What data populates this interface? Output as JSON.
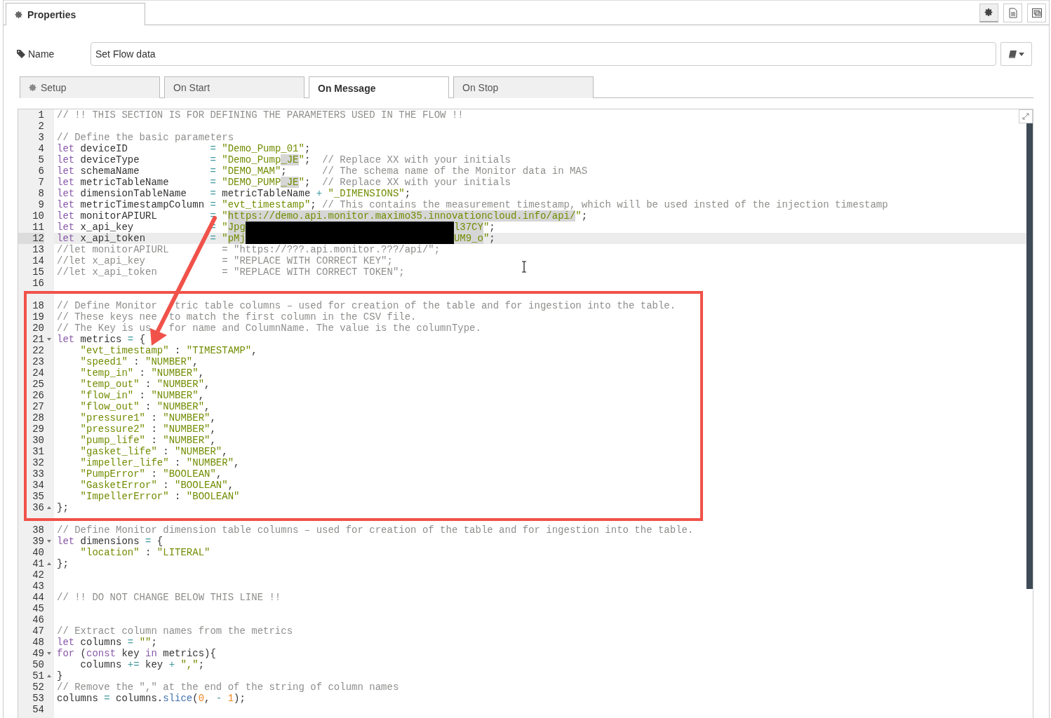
{
  "header": {
    "tab": "Properties",
    "buttons": [
      {
        "kind": "gear",
        "selected": true
      },
      {
        "kind": "document",
        "selected": false
      },
      {
        "kind": "frame",
        "selected": false
      }
    ]
  },
  "name_field": {
    "label": "Name",
    "value": "Set Flow data"
  },
  "tabs": [
    {
      "label": "Setup",
      "kind": "icon",
      "selected": false
    },
    {
      "label": "On Start",
      "kind": "plain",
      "selected": false
    },
    {
      "label": "On Message",
      "kind": "plain",
      "selected": true
    },
    {
      "label": "On Stop",
      "kind": "plain",
      "selected": false
    }
  ],
  "editor": {
    "lines": [
      {
        "number": "1",
        "tokens": [
          {
            "kind": "com",
            "text": "// !! THIS SECTION IS FOR DEFINING THE PARAMETERS USED IN THE FLOW !!"
          }
        ]
      },
      {
        "number": "2"
      },
      {
        "number": "3",
        "tokens": [
          {
            "kind": "com",
            "text": "// Define the basic parameters"
          }
        ]
      },
      {
        "number": "4",
        "tokens": [
          {
            "kind": "kw",
            "text": "let"
          },
          {
            "kind": "txt",
            "text": " deviceID              "
          },
          {
            "kind": "op",
            "text": "= "
          },
          {
            "kind": "str",
            "text": "\"Demo_Pump_01\""
          },
          {
            "kind": "txt",
            "text": ";"
          }
        ]
      },
      {
        "number": "5",
        "tokens": [
          {
            "kind": "kw",
            "text": "let"
          },
          {
            "kind": "txt",
            "text": " deviceType            "
          },
          {
            "kind": "op",
            "text": "= "
          },
          {
            "kind": "str",
            "text": "\"Demo_Pump"
          },
          {
            "kind": "str",
            "text": "_JE",
            "highlighted": true
          },
          {
            "kind": "str",
            "text": "\""
          },
          {
            "kind": "txt",
            "text": ";  "
          },
          {
            "kind": "com",
            "text": "// Replace XX with your initials"
          }
        ]
      },
      {
        "number": "6",
        "tokens": [
          {
            "kind": "kw",
            "text": "let"
          },
          {
            "kind": "txt",
            "text": " schemaName            "
          },
          {
            "kind": "op",
            "text": "= "
          },
          {
            "kind": "str",
            "text": "\"DEMO_MAM\""
          },
          {
            "kind": "txt",
            "text": ";      "
          },
          {
            "kind": "com",
            "text": "// The schema name of the Monitor data in MAS"
          }
        ]
      },
      {
        "number": "7",
        "tokens": [
          {
            "kind": "kw",
            "text": "let"
          },
          {
            "kind": "txt",
            "text": " metricTableName       "
          },
          {
            "kind": "op",
            "text": "= "
          },
          {
            "kind": "str",
            "text": "\"DEMO_PUMP"
          },
          {
            "kind": "str",
            "text": "_JE",
            "highlighted": true
          },
          {
            "kind": "str",
            "text": "\""
          },
          {
            "kind": "txt",
            "text": ";  "
          },
          {
            "kind": "com",
            "text": "// Replace XX with your initials"
          }
        ]
      },
      {
        "number": "8",
        "tokens": [
          {
            "kind": "kw",
            "text": "let"
          },
          {
            "kind": "txt",
            "text": " dimensionTableName    "
          },
          {
            "kind": "op",
            "text": "= "
          },
          {
            "kind": "txt",
            "text": "metricTableName "
          },
          {
            "kind": "op",
            "text": "+ "
          },
          {
            "kind": "str",
            "text": "\"_DIMENSIONS\""
          },
          {
            "kind": "txt",
            "text": ";"
          }
        ]
      },
      {
        "number": "9",
        "tokens": [
          {
            "kind": "kw",
            "text": "let"
          },
          {
            "kind": "txt",
            "text": " metricTimestampColumn "
          },
          {
            "kind": "op",
            "text": "= "
          },
          {
            "kind": "str",
            "text": "\"evt_timestamp\""
          },
          {
            "kind": "txt",
            "text": "; "
          },
          {
            "kind": "com",
            "text": "// This contains the measurement timestamp, which will be used insted of the injection timestamp"
          }
        ]
      },
      {
        "number": "10",
        "tokens": [
          {
            "kind": "kw",
            "text": "let"
          },
          {
            "kind": "txt",
            "text": " monitorAPIURL         "
          },
          {
            "kind": "op",
            "text": "= "
          },
          {
            "kind": "str",
            "text": "\""
          },
          {
            "kind": "str",
            "text": "https://demo.api.monitor.maximo35.innovationcloud.info/api/",
            "highlighted": true
          },
          {
            "kind": "str",
            "text": "\""
          },
          {
            "kind": "txt",
            "text": ";"
          }
        ]
      },
      {
        "number": "11",
        "tokens": [
          {
            "kind": "kw",
            "text": "let"
          },
          {
            "kind": "txt",
            "text": " x_api_key             "
          },
          {
            "kind": "op",
            "text": "= "
          },
          {
            "kind": "str",
            "text": "\""
          },
          {
            "kind": "str",
            "text": "Jpg",
            "highlighted": true
          },
          {
            "kind": "redacted"
          },
          {
            "kind": "str",
            "text": "l37CY",
            "highlighted": true
          },
          {
            "kind": "str",
            "text": "\""
          },
          {
            "kind": "txt",
            "text": ";"
          }
        ]
      },
      {
        "number": "12",
        "active": true,
        "tokens": [
          {
            "kind": "kw",
            "text": "let"
          },
          {
            "kind": "txt",
            "text": " x_api_token           "
          },
          {
            "kind": "op",
            "text": "= "
          },
          {
            "kind": "str",
            "text": "\""
          },
          {
            "kind": "str",
            "text": "pMj",
            "highlighted": true
          },
          {
            "kind": "redacted"
          },
          {
            "kind": "str",
            "text": "UM9_o",
            "highlighted": true
          },
          {
            "kind": "str",
            "text": "\""
          },
          {
            "kind": "txt",
            "text": ";"
          }
        ]
      },
      {
        "number": "13",
        "tokens": [
          {
            "kind": "com",
            "text": "//let monitorAPIURL         = \"https://???.api.monitor.???/api/\";"
          }
        ]
      },
      {
        "number": "14",
        "tokens": [
          {
            "kind": "com",
            "text": "//let x_api_key             = \"REPLACE WITH CORRECT KEY\";"
          }
        ]
      },
      {
        "number": "15",
        "tokens": [
          {
            "kind": "com",
            "text": "//let x_api_token           = \"REPLACE WITH CORRECT TOKEN\";"
          }
        ]
      },
      {
        "number": "16"
      }
    ],
    "boxed_lines": [
      {
        "number": "18",
        "tokens": [
          {
            "kind": "com",
            "text": "// Define Monitor "
          },
          {
            "kind": "gap"
          },
          {
            "kind": "com",
            "text": "tric table columns – used for creation of the table and for ingestion into the table."
          }
        ]
      },
      {
        "number": "19",
        "tokens": [
          {
            "kind": "com",
            "text": "// These keys nee"
          },
          {
            "kind": "gap"
          },
          {
            "kind": "com",
            "text": "to match the first column in the CSV file."
          }
        ]
      },
      {
        "number": "20",
        "tokens": [
          {
            "kind": "com",
            "text": "// The Key is us"
          },
          {
            "kind": "gap"
          },
          {
            "kind": "com",
            "text": " for name and ColumnName. The value is the columnType."
          }
        ]
      },
      {
        "number": "21",
        "expanded": true,
        "tokens": [
          {
            "kind": "kw",
            "text": "let"
          },
          {
            "kind": "txt",
            "text": " metrics "
          },
          {
            "kind": "op",
            "text": "= "
          },
          {
            "kind": "txt",
            "text": "{"
          }
        ]
      },
      {
        "number": "22",
        "tokens": [
          {
            "kind": "str",
            "text": "    \"evt_timestamp\""
          },
          {
            "kind": "txt",
            "text": " : "
          },
          {
            "kind": "str",
            "text": "\"TIMESTAMP\""
          },
          {
            "kind": "txt",
            "text": ","
          }
        ]
      },
      {
        "number": "23",
        "tokens": [
          {
            "kind": "str",
            "text": "    \"speed1\""
          },
          {
            "kind": "txt",
            "text": " : "
          },
          {
            "kind": "str",
            "text": "\"NUMBER\""
          },
          {
            "kind": "txt",
            "text": ","
          }
        ]
      },
      {
        "number": "24",
        "tokens": [
          {
            "kind": "str",
            "text": "    \"temp_in\""
          },
          {
            "kind": "txt",
            "text": " : "
          },
          {
            "kind": "str",
            "text": "\"NUMBER\""
          },
          {
            "kind": "txt",
            "text": ","
          }
        ]
      },
      {
        "number": "25",
        "tokens": [
          {
            "kind": "str",
            "text": "    \"temp_out\""
          },
          {
            "kind": "txt",
            "text": " : "
          },
          {
            "kind": "str",
            "text": "\"NUMBER\""
          },
          {
            "kind": "txt",
            "text": ","
          }
        ]
      },
      {
        "number": "26",
        "tokens": [
          {
            "kind": "str",
            "text": "    \"flow_in\""
          },
          {
            "kind": "txt",
            "text": " : "
          },
          {
            "kind": "str",
            "text": "\"NUMBER\""
          },
          {
            "kind": "txt",
            "text": ","
          }
        ]
      },
      {
        "number": "27",
        "tokens": [
          {
            "kind": "str",
            "text": "    \"flow_out\""
          },
          {
            "kind": "txt",
            "text": " : "
          },
          {
            "kind": "str",
            "text": "\"NUMBER\""
          },
          {
            "kind": "txt",
            "text": ","
          }
        ]
      },
      {
        "number": "28",
        "tokens": [
          {
            "kind": "str",
            "text": "    \"pressure1\""
          },
          {
            "kind": "txt",
            "text": " : "
          },
          {
            "kind": "str",
            "text": "\"NUMBER\""
          },
          {
            "kind": "txt",
            "text": ","
          }
        ]
      },
      {
        "number": "29",
        "tokens": [
          {
            "kind": "str",
            "text": "    \"pressure2\""
          },
          {
            "kind": "txt",
            "text": " : "
          },
          {
            "kind": "str",
            "text": "\"NUMBER\""
          },
          {
            "kind": "txt",
            "text": ","
          }
        ]
      },
      {
        "number": "30",
        "tokens": [
          {
            "kind": "str",
            "text": "    \"pump_life\""
          },
          {
            "kind": "txt",
            "text": " : "
          },
          {
            "kind": "str",
            "text": "\"NUMBER\""
          },
          {
            "kind": "txt",
            "text": ","
          }
        ]
      },
      {
        "number": "31",
        "tokens": [
          {
            "kind": "str",
            "text": "    \"gasket_life\""
          },
          {
            "kind": "txt",
            "text": " : "
          },
          {
            "kind": "str",
            "text": "\"NUMBER\""
          },
          {
            "kind": "txt",
            "text": ","
          }
        ]
      },
      {
        "number": "32",
        "tokens": [
          {
            "kind": "str",
            "text": "    \"impeller_life\""
          },
          {
            "kind": "txt",
            "text": " : "
          },
          {
            "kind": "str",
            "text": "\"NUMBER\""
          },
          {
            "kind": "txt",
            "text": ","
          }
        ]
      },
      {
        "number": "33",
        "tokens": [
          {
            "kind": "str",
            "text": "    \"PumpError\""
          },
          {
            "kind": "txt",
            "text": " : "
          },
          {
            "kind": "str",
            "text": "\"BOOLEAN\""
          },
          {
            "kind": "txt",
            "text": ","
          }
        ]
      },
      {
        "number": "34",
        "tokens": [
          {
            "kind": "str",
            "text": "    \"GasketError\""
          },
          {
            "kind": "txt",
            "text": " : "
          },
          {
            "kind": "str",
            "text": "\"BOOLEAN\""
          },
          {
            "kind": "txt",
            "text": ","
          }
        ]
      },
      {
        "number": "35",
        "tokens": [
          {
            "kind": "str",
            "text": "    \"ImpellerError\""
          },
          {
            "kind": "txt",
            "text": " : "
          },
          {
            "kind": "str",
            "text": "\"BOOLEAN\""
          }
        ]
      },
      {
        "number": "36",
        "fold_end": true,
        "tokens": [
          {
            "kind": "txt",
            "text": "};"
          }
        ]
      }
    ],
    "lines_after": [
      {
        "number": "38",
        "tokens": [
          {
            "kind": "com",
            "text": "// Define Monitor dimension table columns – used for creation of the table and for ingestion into the table."
          }
        ]
      },
      {
        "number": "39",
        "expanded": true,
        "tokens": [
          {
            "kind": "kw",
            "text": "let"
          },
          {
            "kind": "txt",
            "text": " dimensions "
          },
          {
            "kind": "op",
            "text": "= "
          },
          {
            "kind": "txt",
            "text": "{"
          }
        ]
      },
      {
        "number": "40",
        "tokens": [
          {
            "kind": "str",
            "text": "    \"location\""
          },
          {
            "kind": "txt",
            "text": " : "
          },
          {
            "kind": "str",
            "text": "\"LITERAL\""
          }
        ]
      },
      {
        "number": "41",
        "fold_end": true,
        "tokens": [
          {
            "kind": "txt",
            "text": "};"
          }
        ]
      },
      {
        "number": "42"
      },
      {
        "number": "43"
      },
      {
        "number": "44",
        "tokens": [
          {
            "kind": "com",
            "text": "// !! DO NOT CHANGE BELOW THIS LINE !!"
          }
        ]
      },
      {
        "number": "45"
      },
      {
        "number": "46"
      },
      {
        "number": "47",
        "tokens": [
          {
            "kind": "com",
            "text": "// Extract column names from the metrics"
          }
        ]
      },
      {
        "number": "48",
        "tokens": [
          {
            "kind": "kw",
            "text": "let"
          },
          {
            "kind": "txt",
            "text": " columns "
          },
          {
            "kind": "op",
            "text": "= "
          },
          {
            "kind": "str",
            "text": "\"\""
          },
          {
            "kind": "txt",
            "text": ";"
          }
        ]
      },
      {
        "number": "49",
        "expanded": true,
        "tokens": [
          {
            "kind": "kw",
            "text": "for"
          },
          {
            "kind": "txt",
            "text": " ("
          },
          {
            "kind": "kw",
            "text": "const"
          },
          {
            "kind": "txt",
            "text": " key "
          },
          {
            "kind": "kw",
            "text": "in"
          },
          {
            "kind": "txt",
            "text": " metrics){"
          }
        ]
      },
      {
        "number": "50",
        "tokens": [
          {
            "kind": "txt",
            "text": "    columns "
          },
          {
            "kind": "op",
            "text": "+= "
          },
          {
            "kind": "txt",
            "text": "key "
          },
          {
            "kind": "op",
            "text": "+ "
          },
          {
            "kind": "str",
            "text": "\",\""
          },
          {
            "kind": "txt",
            "text": ";"
          }
        ]
      },
      {
        "number": "51",
        "fold_end": true,
        "tokens": [
          {
            "kind": "txt",
            "text": "}"
          }
        ]
      },
      {
        "number": "52",
        "tokens": [
          {
            "kind": "com",
            "text": "// Remove the \",\" at the end of the string of column names"
          }
        ]
      },
      {
        "number": "53",
        "tokens": [
          {
            "kind": "txt",
            "text": "columns "
          },
          {
            "kind": "op",
            "text": "= "
          },
          {
            "kind": "txt",
            "text": "columns."
          },
          {
            "kind": "fn",
            "text": "slice"
          },
          {
            "kind": "txt",
            "text": "("
          },
          {
            "kind": "num",
            "text": "0"
          },
          {
            "kind": "txt",
            "text": ", "
          },
          {
            "kind": "op",
            "text": "- "
          },
          {
            "kind": "num",
            "text": "1"
          },
          {
            "kind": "txt",
            "text": ");"
          }
        ]
      },
      {
        "number": "54"
      }
    ]
  }
}
